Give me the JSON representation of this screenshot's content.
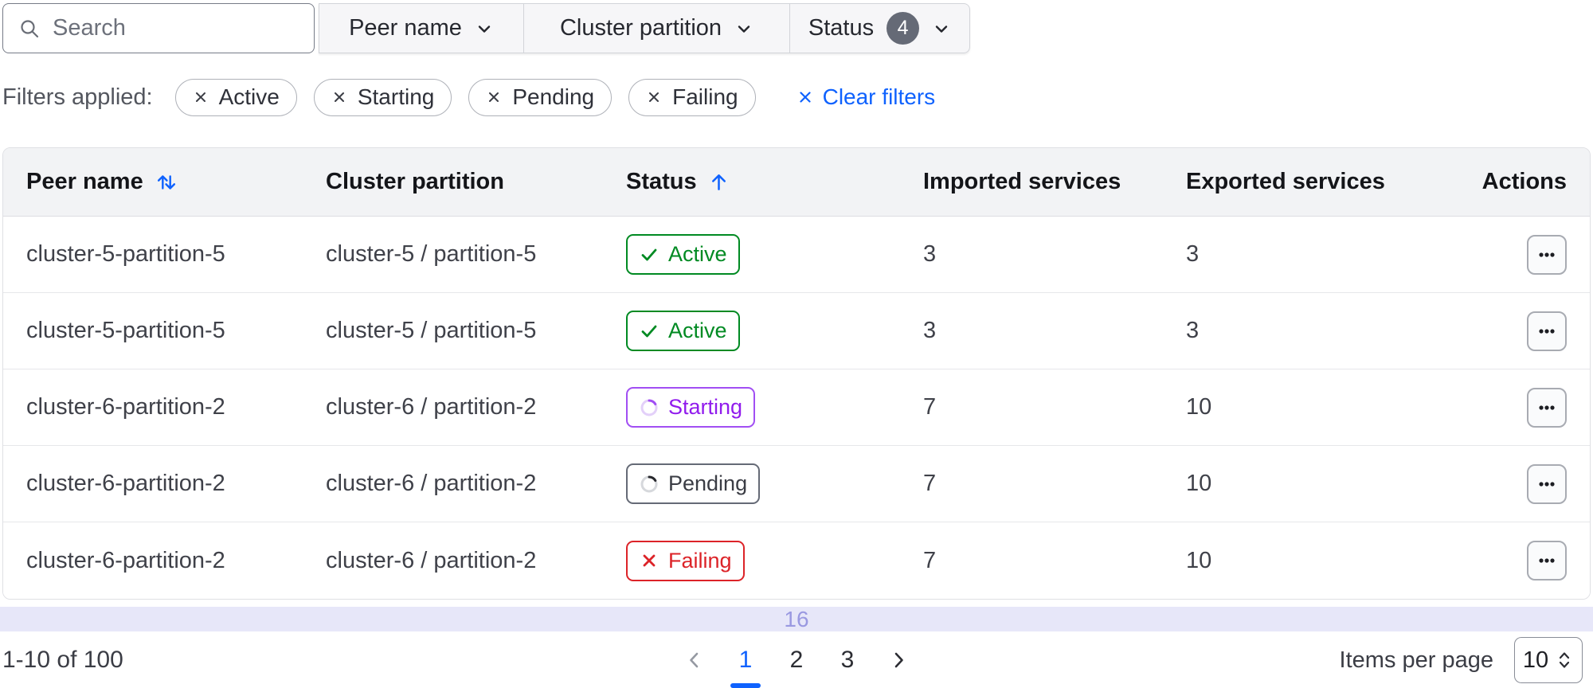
{
  "toolbar": {
    "search_placeholder": "Search",
    "filter_dropdowns": [
      {
        "label": "Peer name"
      },
      {
        "label": "Cluster partition"
      },
      {
        "label": "Status",
        "count_badge": "4"
      }
    ]
  },
  "filters_applied": {
    "label": "Filters applied:",
    "chips": [
      {
        "label": "Active"
      },
      {
        "label": "Starting"
      },
      {
        "label": "Pending"
      },
      {
        "label": "Failing"
      }
    ],
    "clear_label": "Clear filters"
  },
  "table": {
    "columns": {
      "peer_name": "Peer name",
      "cluster_partition": "Cluster partition",
      "status": "Status",
      "imported": "Imported services",
      "exported": "Exported services",
      "actions": "Actions"
    },
    "sort": {
      "peer_name": "unsorted",
      "status": "ascending"
    },
    "rows": [
      {
        "peer_name": "cluster-5-partition-5",
        "cluster_partition": "cluster-5 / partition-5",
        "status": "Active",
        "imported": "3",
        "exported": "3"
      },
      {
        "peer_name": "cluster-5-partition-5",
        "cluster_partition": "cluster-5 / partition-5",
        "status": "Active",
        "imported": "3",
        "exported": "3"
      },
      {
        "peer_name": "cluster-6-partition-2",
        "cluster_partition": "cluster-6 / partition-2",
        "status": "Starting",
        "imported": "7",
        "exported": "10"
      },
      {
        "peer_name": "cluster-6-partition-2",
        "cluster_partition": "cluster-6 / partition-2",
        "status": "Pending",
        "imported": "7",
        "exported": "10"
      },
      {
        "peer_name": "cluster-6-partition-2",
        "cluster_partition": "cluster-6 / partition-2",
        "status": "Failing",
        "imported": "7",
        "exported": "10"
      }
    ],
    "footer_indicator": "16"
  },
  "pagination": {
    "range_label": "1-10 of 100",
    "pages": [
      "1",
      "2",
      "3"
    ],
    "active_page": "1",
    "items_per_page_label": "Items per page",
    "items_per_page_value": "10"
  },
  "colors": {
    "accent_blue": "#0f62fe",
    "success_green": "#008a22",
    "progress_purple": "#911ced",
    "critical_red": "#dc2328",
    "neutral_gray": "#656a76",
    "loading_bar_bg": "#e7e7f9",
    "loading_bar_text": "#9a99e1"
  }
}
